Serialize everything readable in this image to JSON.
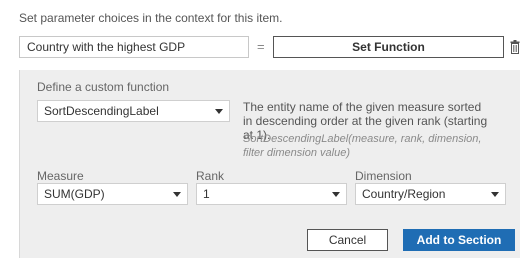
{
  "intro_text": "Set parameter choices in the context for this item.",
  "parameter": {
    "value": "Country with the highest GDP"
  },
  "equals_sign": "=",
  "set_function_label": "Set Function",
  "custom_function": {
    "heading": "Define a custom function",
    "function_select": "SortDescendingLabel",
    "description": "The entity name of the given measure sorted in descending order at the given rank (starting at 1).",
    "syntax": "SortDescendingLabel(measure, rank, dimension, filter dimension value)",
    "measure_label": "Measure",
    "measure_value": "SUM(GDP)",
    "rank_label": "Rank",
    "rank_value": "1",
    "dimension_label": "Dimension",
    "dimension_value": "Country/Region"
  },
  "actions": {
    "cancel": "Cancel",
    "add": "Add to Section"
  },
  "colors": {
    "primary": "#1f6db4",
    "panel": "#eeeeee"
  }
}
